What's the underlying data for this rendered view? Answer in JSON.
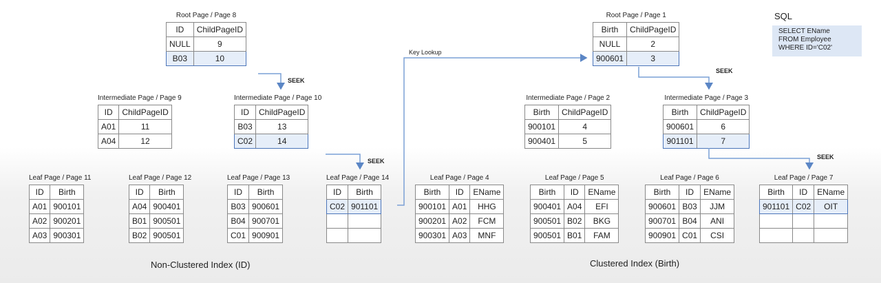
{
  "sql": {
    "title": "SQL",
    "lines": [
      "SELECT EName",
      "FROM Employee",
      "WHERE ID='C02'"
    ]
  },
  "sections": {
    "nonclustered": "Non-Clustered Index (ID)",
    "clustered": "Clustered Index (Birth)"
  },
  "labels": {
    "seek": "SEEK",
    "key_lookup": "Key Lookup"
  },
  "pages": [
    {
      "id": "p8",
      "title": "Root Page / Page 8",
      "columns": [
        "ID",
        "ChildPageID"
      ],
      "rows": [
        [
          "NULL",
          "9"
        ],
        [
          "B03",
          "10"
        ]
      ],
      "highlight": 1
    },
    {
      "id": "p9",
      "title": "Intermediate Page / Page 9",
      "columns": [
        "ID",
        "ChildPageID"
      ],
      "rows": [
        [
          "A01",
          "11"
        ],
        [
          "A04",
          "12"
        ]
      ],
      "highlight": -1
    },
    {
      "id": "p10",
      "title": "Intermediate Page / Page 10",
      "columns": [
        "ID",
        "ChildPageID"
      ],
      "rows": [
        [
          "B03",
          "13"
        ],
        [
          "C02",
          "14"
        ]
      ],
      "highlight": 1
    },
    {
      "id": "p11",
      "title": "Leaf Page / Page 11",
      "columns": [
        "ID",
        "Birth"
      ],
      "rows": [
        [
          "A01",
          "900101"
        ],
        [
          "A02",
          "900201"
        ],
        [
          "A03",
          "900301"
        ]
      ],
      "highlight": -1
    },
    {
      "id": "p12",
      "title": "Leaf Page / Page 12",
      "columns": [
        "ID",
        "Birth"
      ],
      "rows": [
        [
          "A04",
          "900401"
        ],
        [
          "B01",
          "900501"
        ],
        [
          "B02",
          "900501"
        ]
      ],
      "highlight": -1
    },
    {
      "id": "p13",
      "title": "Leaf Page / Page 13",
      "columns": [
        "ID",
        "Birth"
      ],
      "rows": [
        [
          "B03",
          "900601"
        ],
        [
          "B04",
          "900701"
        ],
        [
          "C01",
          "900901"
        ]
      ],
      "highlight": -1
    },
    {
      "id": "p14",
      "title": "Leaf Page / Page 14",
      "columns": [
        "ID",
        "Birth"
      ],
      "rows": [
        [
          "C02",
          "901101"
        ],
        [
          "",
          ""
        ],
        [
          "",
          ""
        ]
      ],
      "highlight": 0
    },
    {
      "id": "p1",
      "title": "Root Page / Page 1",
      "columns": [
        "Birth",
        "ChildPageID"
      ],
      "rows": [
        [
          "NULL",
          "2"
        ],
        [
          "900601",
          "3"
        ]
      ],
      "highlight": 1
    },
    {
      "id": "p2",
      "title": "Intermediate Page / Page 2",
      "columns": [
        "Birth",
        "ChildPageID"
      ],
      "rows": [
        [
          "900101",
          "4"
        ],
        [
          "900401",
          "5"
        ]
      ],
      "highlight": -1
    },
    {
      "id": "p3",
      "title": "Intermediate Page / Page 3",
      "columns": [
        "Birth",
        "ChildPageID"
      ],
      "rows": [
        [
          "900601",
          "6"
        ],
        [
          "901101",
          "7"
        ]
      ],
      "highlight": 1
    },
    {
      "id": "p4",
      "title": "Leaf Page / Page 4",
      "columns": [
        "Birth",
        "ID",
        "EName"
      ],
      "rows": [
        [
          "900101",
          "A01",
          "HHG"
        ],
        [
          "900201",
          "A02",
          "FCM"
        ],
        [
          "900301",
          "A03",
          "MNF"
        ]
      ],
      "highlight": -1
    },
    {
      "id": "p5",
      "title": "Leaf Page / Page 5",
      "columns": [
        "Birth",
        "ID",
        "EName"
      ],
      "rows": [
        [
          "900401",
          "A04",
          "EFI"
        ],
        [
          "900501",
          "B02",
          "BKG"
        ],
        [
          "900501",
          "B01",
          "FAM"
        ]
      ],
      "highlight": -1
    },
    {
      "id": "p6",
      "title": "Leaf Page / Page 6",
      "columns": [
        "Birth",
        "ID",
        "EName"
      ],
      "rows": [
        [
          "900601",
          "B03",
          "JJM"
        ],
        [
          "900701",
          "B04",
          "ANI"
        ],
        [
          "900901",
          "C01",
          "CSI"
        ]
      ],
      "highlight": -1
    },
    {
      "id": "p7",
      "title": "Leaf Page / Page 7",
      "columns": [
        "Birth",
        "ID",
        "EName"
      ],
      "rows": [
        [
          "901101",
          "C02",
          "OIT"
        ],
        [
          "",
          "",
          ""
        ],
        [
          "",
          "",
          ""
        ]
      ],
      "highlight": 0
    }
  ]
}
